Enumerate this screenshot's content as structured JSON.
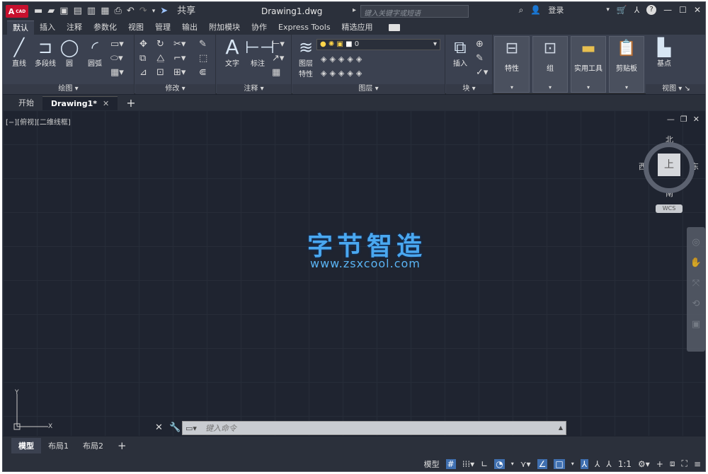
{
  "app": {
    "logo_letter": "A",
    "logo_sub": "CAD",
    "document_title": "Drawing1.dwg"
  },
  "titlebar": {
    "share_label": "共享",
    "search_placeholder": "键入关键字或短语",
    "login_label": "登录",
    "help_label": "?"
  },
  "ribbon_tabs": [
    "默认",
    "插入",
    "注释",
    "参数化",
    "视图",
    "管理",
    "输出",
    "附加模块",
    "协作",
    "Express Tools",
    "精选应用"
  ],
  "ribbon": {
    "draw": {
      "title": "绘图",
      "line": "直线",
      "polyline": "多段线",
      "circle": "圆",
      "arc": "圆弧"
    },
    "modify": {
      "title": "修改"
    },
    "annotation": {
      "title": "注释",
      "text": "文字",
      "dimension": "标注"
    },
    "layers": {
      "title": "图层",
      "properties": "图层\n特性",
      "current_layer": "0",
      "properties_l1": "图层",
      "properties_l2": "特性"
    },
    "block": {
      "title": "块",
      "insert": "插入"
    },
    "properties": "特性",
    "groups": "组",
    "utilities": "实用工具",
    "clipboard": "剪贴板",
    "view": {
      "title": "视图",
      "base": "基点"
    }
  },
  "doc_tabs": {
    "start": "开始",
    "active": "Drawing1*"
  },
  "canvas": {
    "view_label": "[−][俯视][二维线框]",
    "viewcube": {
      "north": "北",
      "south": "南",
      "east": "东",
      "west": "西",
      "face": "上",
      "wcs": "WCS"
    },
    "watermark_title": "字节智造",
    "watermark_url": "www.zsxcool.com",
    "ucs_y": "Y",
    "ucs_x": "X"
  },
  "command_line": {
    "placeholder": "键入命令"
  },
  "layout_tabs": [
    "模型",
    "布局1",
    "布局2"
  ],
  "statusbar": {
    "model_label": "模型",
    "scale_label": "1:1"
  },
  "colors": {
    "canvas_bg": "#1f2430",
    "ribbon_bg": "#3b4150",
    "accent": "#3f6fb0",
    "logo_red": "#c8102e"
  }
}
